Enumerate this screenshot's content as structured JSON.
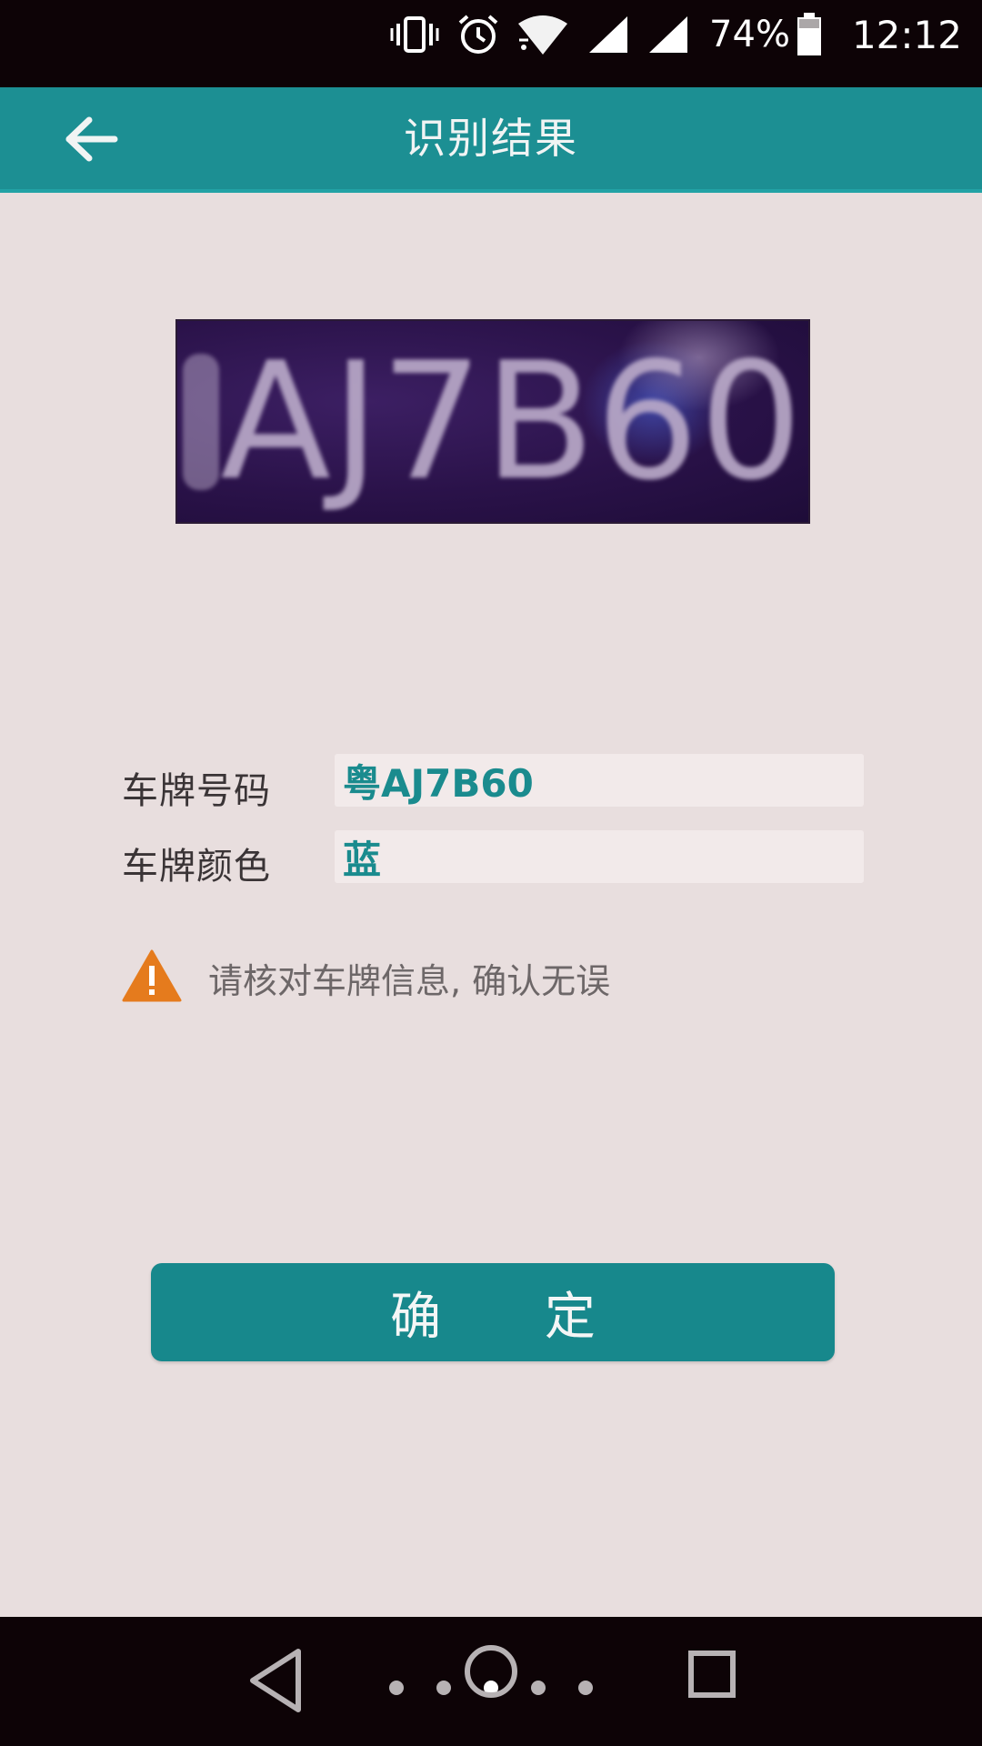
{
  "status_bar": {
    "battery_percent": "74%",
    "time": "12:12",
    "icons": [
      "vibrate-icon",
      "alarm-icon",
      "wifi-icon",
      "signal-icon",
      "signal-icon",
      "battery-icon"
    ]
  },
  "header": {
    "title": "识别结果",
    "back_icon": "back-arrow-icon"
  },
  "plate_image": {
    "visible_chars": [
      "",
      "A",
      "J",
      "7",
      "B",
      "6",
      "0"
    ]
  },
  "fields": {
    "plate_number": {
      "label": "车牌号码",
      "value": "粤AJ7B60"
    },
    "plate_color": {
      "label": "车牌颜色",
      "value": "蓝"
    }
  },
  "notice": {
    "icon": "warning-icon",
    "text": "请核对车牌信息, 确认无误"
  },
  "actions": {
    "confirm_label": "确 定"
  },
  "nav_bar": {
    "icons": [
      "nav-back-icon",
      "nav-home-icon",
      "nav-recents-icon"
    ],
    "page_count": 5,
    "active_page": 3
  },
  "colors": {
    "accent": "#1c8f93",
    "background": "#e8dede",
    "value_text": "#1a8b8e",
    "warning": "#e57b1d"
  }
}
